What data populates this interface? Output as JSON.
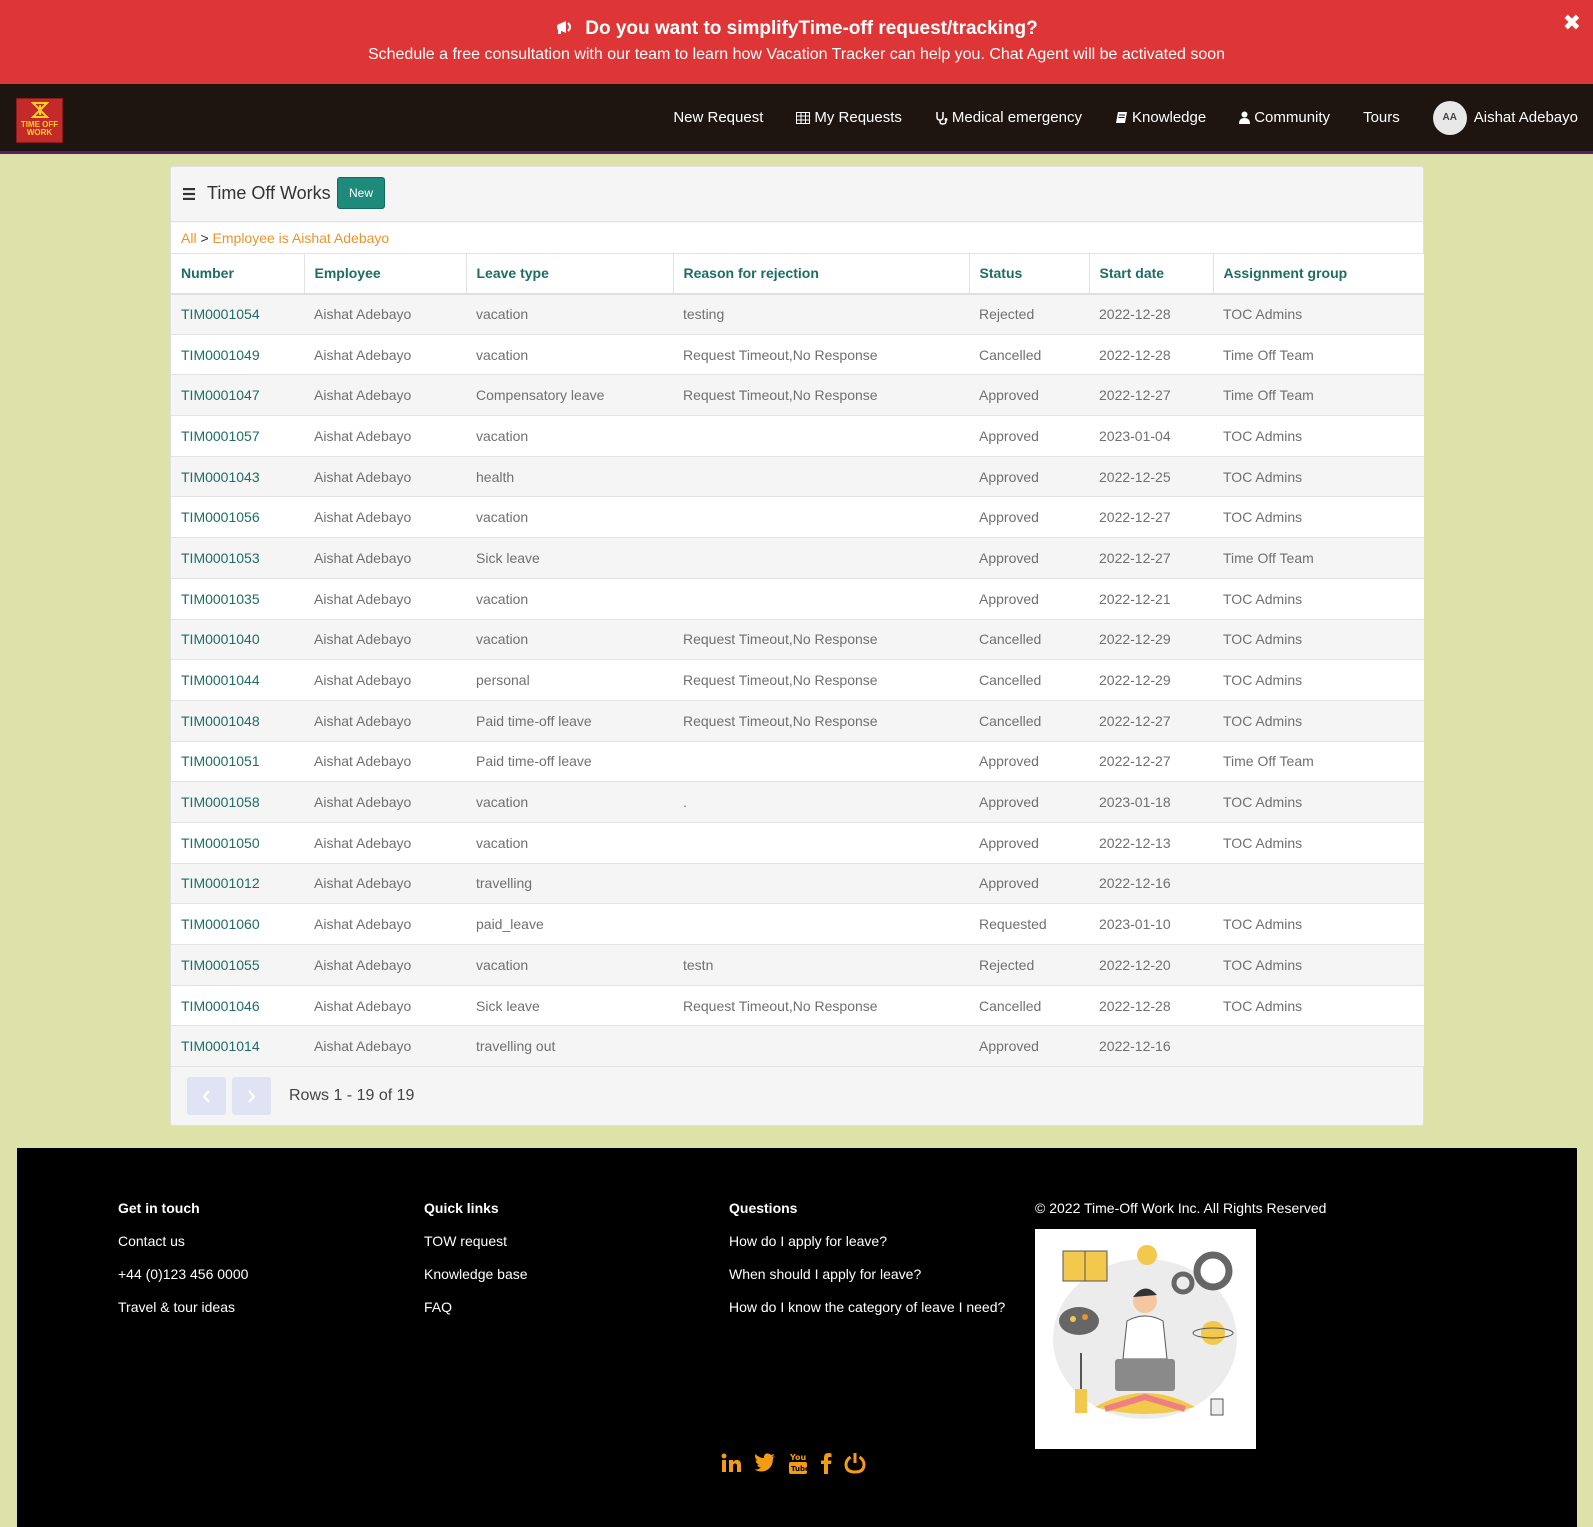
{
  "banner": {
    "title": "Do you want to simplifyTime-off request/tracking?",
    "subtitle": "Schedule a free consultation with our team to learn how Vacation Tracker can help you. Chat Agent will be activated soon",
    "close_label": "✖"
  },
  "brand": {
    "logo_text_1": "TIME OFF",
    "logo_text_2": "WORK"
  },
  "nav": {
    "new_request": "New Request",
    "my_requests": "My Requests",
    "medical": "Medical emergency",
    "knowledge": "Knowledge",
    "community": "Community",
    "tours": "Tours",
    "user_initials": "AA",
    "user_name": "Aishat Adebayo"
  },
  "panel": {
    "title": "Time Off Works",
    "new_button": "New",
    "breadcrumb": {
      "all": "All",
      "sep": " > ",
      "filter": "Employee is Aishat Adebayo"
    }
  },
  "table": {
    "columns": [
      "Number",
      "Employee",
      "Leave type",
      "Reason for rejection",
      "Status",
      "Start date",
      "Assignment group"
    ],
    "rows": [
      [
        "TIM0001054",
        "Aishat Adebayo",
        "vacation",
        "testing",
        "Rejected",
        "2022-12-28",
        "TOC Admins"
      ],
      [
        "TIM0001049",
        "Aishat Adebayo",
        "vacation",
        "Request Timeout,No Response",
        "Cancelled",
        "2022-12-28",
        "Time Off Team"
      ],
      [
        "TIM0001047",
        "Aishat Adebayo",
        "Compensatory leave",
        "Request Timeout,No Response",
        "Approved",
        "2022-12-27",
        "Time Off Team"
      ],
      [
        "TIM0001057",
        "Aishat Adebayo",
        "vacation",
        "",
        "Approved",
        "2023-01-04",
        "TOC Admins"
      ],
      [
        "TIM0001043",
        "Aishat Adebayo",
        "health",
        "",
        "Approved",
        "2022-12-25",
        "TOC Admins"
      ],
      [
        "TIM0001056",
        "Aishat Adebayo",
        "vacation",
        "",
        "Approved",
        "2022-12-27",
        "TOC Admins"
      ],
      [
        "TIM0001053",
        "Aishat Adebayo",
        "Sick leave",
        "",
        "Approved",
        "2022-12-27",
        "Time Off Team"
      ],
      [
        "TIM0001035",
        "Aishat Adebayo",
        "vacation",
        "",
        "Approved",
        "2022-12-21",
        "TOC Admins"
      ],
      [
        "TIM0001040",
        "Aishat Adebayo",
        "vacation",
        "Request Timeout,No Response",
        "Cancelled",
        "2022-12-29",
        "TOC Admins"
      ],
      [
        "TIM0001044",
        "Aishat Adebayo",
        "personal",
        "Request Timeout,No Response",
        "Cancelled",
        "2022-12-29",
        "TOC Admins"
      ],
      [
        "TIM0001048",
        "Aishat Adebayo",
        "Paid time-off leave",
        "Request Timeout,No Response",
        "Cancelled",
        "2022-12-27",
        "TOC Admins"
      ],
      [
        "TIM0001051",
        "Aishat Adebayo",
        "Paid time-off leave",
        "",
        "Approved",
        "2022-12-27",
        "Time Off Team"
      ],
      [
        "TIM0001058",
        "Aishat Adebayo",
        "vacation",
        ".",
        "Approved",
        "2023-01-18",
        "TOC Admins"
      ],
      [
        "TIM0001050",
        "Aishat Adebayo",
        "vacation",
        "",
        "Approved",
        "2022-12-13",
        "TOC Admins"
      ],
      [
        "TIM0001012",
        "Aishat Adebayo",
        "travelling",
        "",
        "Approved",
        "2022-12-16",
        ""
      ],
      [
        "TIM0001060",
        "Aishat Adebayo",
        "paid_leave",
        "",
        "Requested",
        "2023-01-10",
        "TOC Admins"
      ],
      [
        "TIM0001055",
        "Aishat Adebayo",
        "vacation",
        "testn",
        "Rejected",
        "2022-12-20",
        "TOC Admins"
      ],
      [
        "TIM0001046",
        "Aishat Adebayo",
        "Sick leave",
        "Request Timeout,No Response",
        "Cancelled",
        "2022-12-28",
        "TOC Admins"
      ],
      [
        "TIM0001014",
        "Aishat Adebayo",
        "travelling out",
        "",
        "Approved",
        "2022-12-16",
        ""
      ]
    ]
  },
  "pager": {
    "rows_text": "Rows 1 - 19 of 19"
  },
  "footer": {
    "col1": {
      "heading": "Get in touch",
      "links": [
        "Contact us",
        "+44 (0)123 456 0000",
        "Travel & tour ideas"
      ]
    },
    "col2": {
      "heading": "Quick links",
      "links": [
        "TOW request",
        "Knowledge base",
        "FAQ"
      ]
    },
    "col3": {
      "heading": "Questions",
      "links": [
        "How do I apply for leave?",
        "When should I apply for leave?",
        "How do I know the category of leave I need?"
      ]
    },
    "copyright": "© 2022 Time-Off Work Inc. All Rights Reserved",
    "socials": [
      "linkedin-icon",
      "twitter-icon",
      "youtube-icon",
      "facebook-icon",
      "power-icon"
    ]
  },
  "colors": {
    "banner": "#de3636",
    "navbar": "#1e1510",
    "page_bg": "#dde3a8",
    "accent_teal": "#1e8a7c",
    "link_orange": "#e8952f",
    "social_orange": "#f39c12"
  }
}
